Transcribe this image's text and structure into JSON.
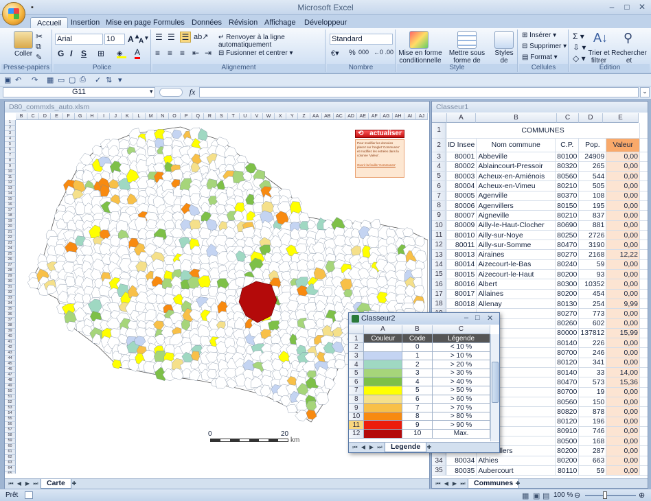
{
  "app": {
    "title": "Microsoft Excel"
  },
  "tabs": [
    "Accueil",
    "Insertion",
    "Mise en page",
    "Formules",
    "Données",
    "Révision",
    "Affichage",
    "Développeur"
  ],
  "ribbon": {
    "clipboard": {
      "paste": "Coller",
      "label": "Presse-papiers"
    },
    "font": {
      "name": "Arial",
      "size": "10",
      "label": "Police",
      "bold": "G",
      "italic": "I",
      "underline": "S"
    },
    "alignment": {
      "wrap": "Renvoyer à la ligne automatiquement",
      "merge": "Fusionner et centrer",
      "label": "Alignement"
    },
    "number": {
      "format": "Standard",
      "label": "Nombre",
      "pct": "%",
      "thousands": "000"
    },
    "style": {
      "cond": "Mise en forme conditionnelle",
      "table": "Mettre sous forme de tableau",
      "cell": "Styles de cellules",
      "label": "Style"
    },
    "cells": {
      "insert": "Insérer",
      "delete": "Supprimer",
      "format": "Format",
      "label": "Cellules"
    },
    "edit": {
      "sort": "Trier et filtrer",
      "find": "Rechercher et sélectionner",
      "label": "Édition"
    }
  },
  "formula": {
    "namebox": "G11",
    "fx": "fx",
    "value": ""
  },
  "map_window": {
    "title": "D80_commxls_auto.xlsm",
    "cols": [
      "B",
      "C",
      "D",
      "E",
      "F",
      "G",
      "H",
      "I",
      "J",
      "K",
      "L",
      "M",
      "N",
      "O",
      "P",
      "Q",
      "R",
      "S",
      "T",
      "U",
      "V",
      "W",
      "X",
      "Y",
      "Z",
      "AA",
      "AB",
      "AC",
      "AD",
      "AE",
      "AF",
      "AG",
      "AH",
      "AI",
      "AJ"
    ],
    "button": "actualiser",
    "note": "Pour modifier les données placez sur l'onglet 'Communes' et modifiez les entrées dans la colonne 'Valeur'.",
    "note_link": "Ouvrir la feuille 'Communes'",
    "scale_0": "0",
    "scale_20": "20",
    "scale_unit": "km",
    "sheet_tab": "Carte"
  },
  "data_window": {
    "title": "Classeur1",
    "cols": [
      "A",
      "B",
      "C",
      "D",
      "E"
    ],
    "header_merged": "COMMUNES",
    "headers": [
      "ID Insee",
      "Nom commune",
      "C.P.",
      "Pop.",
      "Valeur"
    ],
    "rows": [
      [
        "80001",
        "Abbeville",
        "80100",
        "24909",
        "0,00"
      ],
      [
        "80002",
        "Ablaincourt-Pressoir",
        "80320",
        "265",
        "0,00"
      ],
      [
        "80003",
        "Acheux-en-Amiénois",
        "80560",
        "544",
        "0,00"
      ],
      [
        "80004",
        "Acheux-en-Vimeu",
        "80210",
        "505",
        "0,00"
      ],
      [
        "80005",
        "Agenville",
        "80370",
        "108",
        "0,00"
      ],
      [
        "80006",
        "Agenvillers",
        "80150",
        "195",
        "0,00"
      ],
      [
        "80007",
        "Aigneville",
        "80210",
        "837",
        "0,00"
      ],
      [
        "80009",
        "Ailly-le-Haut-Clocher",
        "80690",
        "881",
        "0,00"
      ],
      [
        "80010",
        "Ailly-sur-Noye",
        "80250",
        "2726",
        "0,00"
      ],
      [
        "80011",
        "Ailly-sur-Somme",
        "80470",
        "3190",
        "0,00"
      ],
      [
        "80013",
        "Airaines",
        "80270",
        "2168",
        "12,22"
      ],
      [
        "80014",
        "Aizecourt-le-Bas",
        "80240",
        "59",
        "0,00"
      ],
      [
        "80015",
        "Aizecourt-le-Haut",
        "80200",
        "93",
        "0,00"
      ],
      [
        "80016",
        "Albert",
        "80300",
        "10352",
        "0,00"
      ],
      [
        "80017",
        "Allaines",
        "80200",
        "454",
        "0,00"
      ],
      [
        "80018",
        "Allenay",
        "80130",
        "254",
        "9,99"
      ],
      [
        "",
        "",
        "80270",
        "773",
        "0,00"
      ],
      [
        "",
        "ville",
        "80260",
        "602",
        "0,00"
      ],
      [
        "",
        "",
        "80000",
        "137812",
        "15,99"
      ],
      [
        "",
        "ville",
        "80140",
        "226",
        "0,00"
      ],
      [
        "",
        "y",
        "80700",
        "246",
        "0,00"
      ],
      [
        "",
        "es",
        "80120",
        "341",
        "0,00"
      ],
      [
        "",
        "",
        "80140",
        "33",
        "14,00"
      ],
      [
        "",
        "yes",
        "80470",
        "573",
        "15,36"
      ],
      [
        "",
        "court",
        "80700",
        "19",
        "0,00"
      ],
      [
        "",
        "es",
        "80560",
        "150",
        "0,00"
      ],
      [
        "",
        "",
        "80820",
        "878",
        "0,00"
      ],
      [
        "",
        "",
        "80120",
        "196",
        "0,00"
      ],
      [
        "",
        "rs",
        "80910",
        "746",
        "0,00"
      ],
      [
        "",
        "villers",
        "80500",
        "168",
        "0,00"
      ],
      [
        "80033",
        "Assevillers",
        "80200",
        "287",
        "0,00"
      ],
      [
        "80034",
        "Athies",
        "80200",
        "663",
        "0,00"
      ],
      [
        "80035",
        "Aubercourt",
        "80110",
        "59",
        "0,00"
      ]
    ],
    "sheet_tab": "Communes"
  },
  "legend_window": {
    "title": "Classeur2",
    "cols": [
      "A",
      "B",
      "C"
    ],
    "headers": [
      "Couleur",
      "Code",
      "Légende"
    ],
    "rows": [
      {
        "color": "#ffffff",
        "code": "0",
        "label": "< 10 %"
      },
      {
        "color": "#c4d4f2",
        "code": "1",
        "label": "> 10 %"
      },
      {
        "color": "#9fd8c2",
        "code": "2",
        "label": "> 20 %"
      },
      {
        "color": "#a6d57a",
        "code": "3",
        "label": "> 30 %"
      },
      {
        "color": "#7ec048",
        "code": "4",
        "label": "> 40 %"
      },
      {
        "color": "#ffff00",
        "code": "5",
        "label": "> 50 %"
      },
      {
        "color": "#f5e08a",
        "code": "6",
        "label": "> 60 %"
      },
      {
        "color": "#f8c048",
        "code": "7",
        "label": "> 70 %"
      },
      {
        "color": "#f88a10",
        "code": "8",
        "label": "> 80 %"
      },
      {
        "color": "#ec1c0c",
        "code": "9",
        "label": "> 90 %"
      },
      {
        "color": "#b40a0a",
        "code": "10",
        "label": "Max."
      }
    ],
    "sheet_tab": "Legende"
  },
  "status": {
    "text": "Prêt",
    "zoom": "100 %"
  }
}
